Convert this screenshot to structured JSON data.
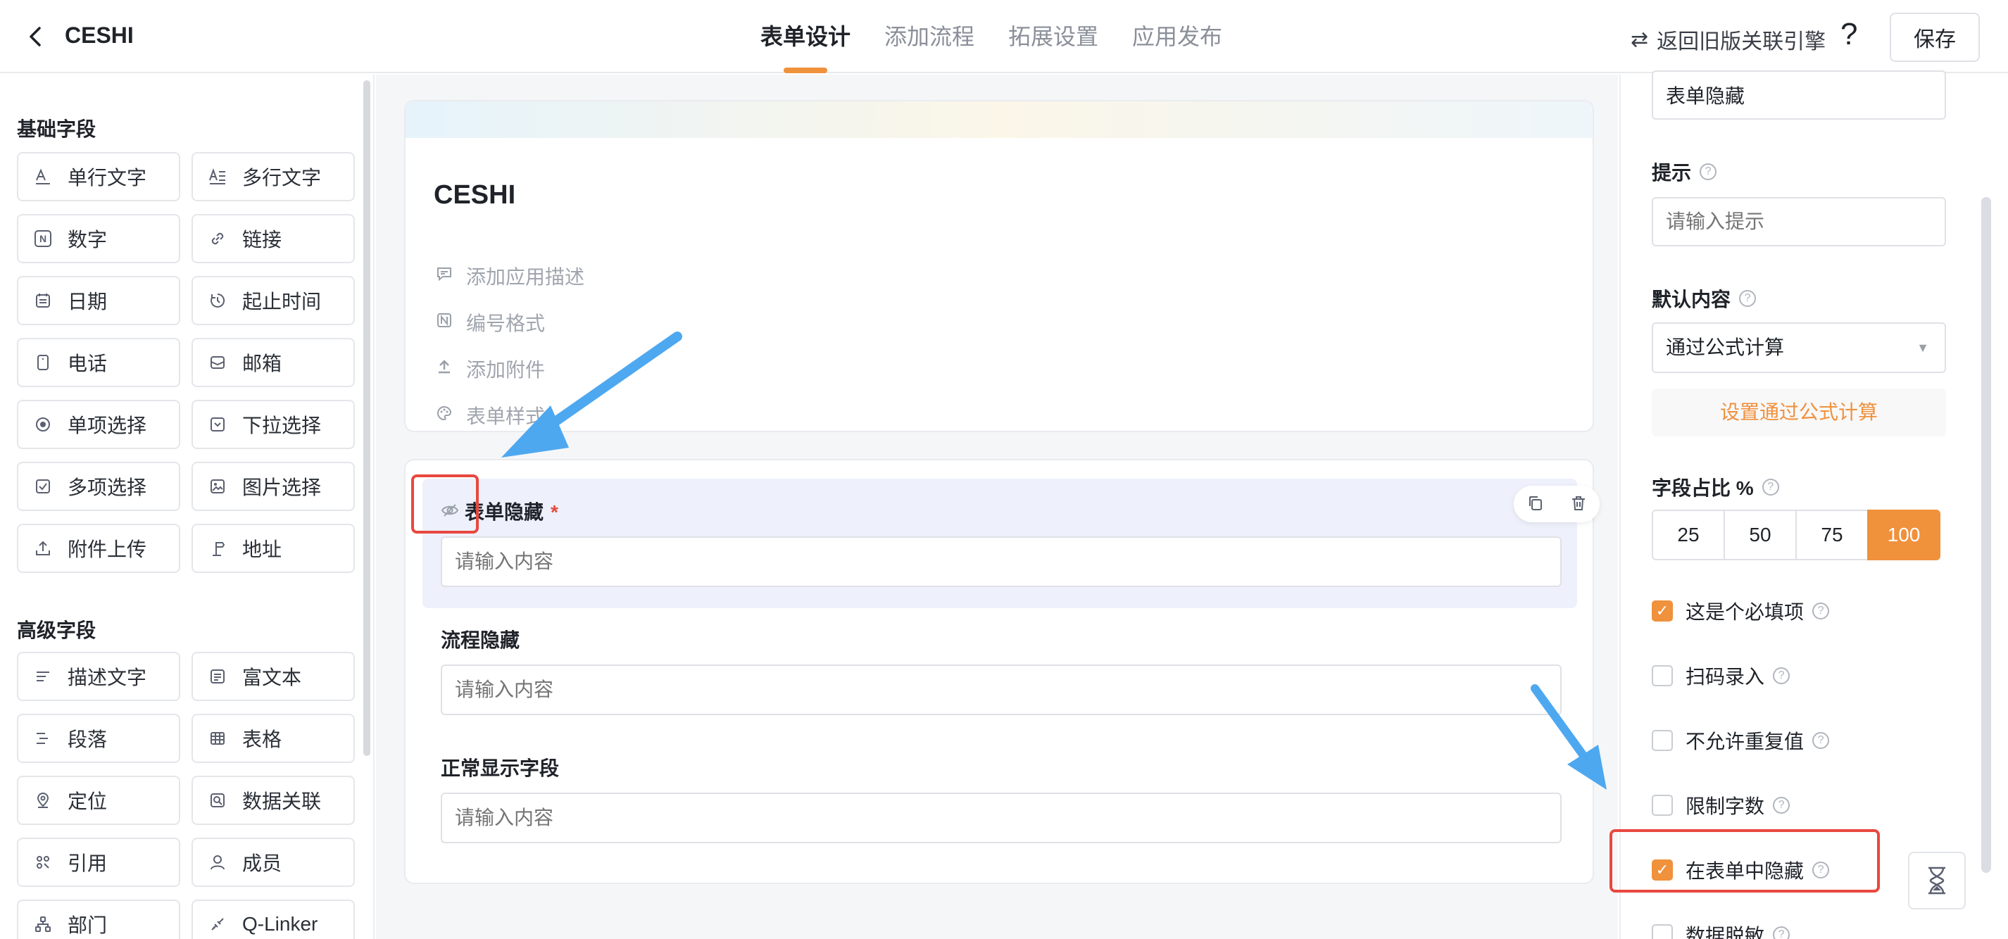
{
  "header": {
    "app_title": "CESHI",
    "tabs": [
      {
        "label": "表单设计"
      },
      {
        "label": "添加流程"
      },
      {
        "label": "拓展设置"
      },
      {
        "label": "应用发布"
      }
    ],
    "active_tab": "表单设计",
    "legacy_link": "返回旧版关联引擎",
    "help": "?",
    "save_label": "保存"
  },
  "left_panel": {
    "basic_title": "基础字段",
    "basic_fields": [
      {
        "label": "单行文字",
        "icon": "single-line-text-icon"
      },
      {
        "label": "多行文字",
        "icon": "multi-line-text-icon"
      },
      {
        "label": "数字",
        "icon": "number-icon"
      },
      {
        "label": "链接",
        "icon": "link-icon"
      },
      {
        "label": "日期",
        "icon": "calendar-icon"
      },
      {
        "label": "起止时间",
        "icon": "time-range-icon"
      },
      {
        "label": "电话",
        "icon": "phone-icon"
      },
      {
        "label": "邮箱",
        "icon": "mail-icon"
      },
      {
        "label": "单项选择",
        "icon": "radio-icon"
      },
      {
        "label": "下拉选择",
        "icon": "dropdown-icon"
      },
      {
        "label": "多项选择",
        "icon": "checkbox-icon"
      },
      {
        "label": "图片选择",
        "icon": "image-icon"
      },
      {
        "label": "附件上传",
        "icon": "upload-icon"
      },
      {
        "label": "地址",
        "icon": "address-icon"
      }
    ],
    "advanced_title": "高级字段",
    "advanced_fields": [
      {
        "label": "描述文字",
        "icon": "description-icon"
      },
      {
        "label": "富文本",
        "icon": "rich-text-icon"
      },
      {
        "label": "段落",
        "icon": "paragraph-icon"
      },
      {
        "label": "表格",
        "icon": "table-icon"
      },
      {
        "label": "定位",
        "icon": "location-icon"
      },
      {
        "label": "数据关联",
        "icon": "data-link-icon"
      },
      {
        "label": "引用",
        "icon": "reference-icon"
      },
      {
        "label": "成员",
        "icon": "member-icon"
      },
      {
        "label": "部门",
        "icon": "department-icon"
      },
      {
        "label": "Q-Linker",
        "icon": "qlinker-icon"
      }
    ]
  },
  "canvas": {
    "form_title": "CESHI",
    "meta_items": [
      {
        "label": "添加应用描述",
        "icon": "comment-icon"
      },
      {
        "label": "编号格式",
        "icon": "number-format-icon"
      },
      {
        "label": "添加附件",
        "icon": "attachment-upload-icon"
      },
      {
        "label": "表单样式",
        "icon": "palette-icon"
      }
    ],
    "fields": [
      {
        "label": "表单隐藏",
        "required": "*",
        "placeholder": "请输入内容"
      },
      {
        "label": "流程隐藏",
        "placeholder": "请输入内容"
      },
      {
        "label": "正常显示字段",
        "placeholder": "请输入内容"
      }
    ]
  },
  "right_panel": {
    "title_value": "表单隐藏",
    "hint_label": "提示",
    "hint_placeholder": "请输入提示",
    "default_label": "默认内容",
    "default_value": "通过公式计算",
    "formula_button": "设置通过公式计算",
    "ratio_label": "字段占比 %",
    "ratio_options": [
      "25",
      "50",
      "75",
      "100"
    ],
    "ratio_selected": "100",
    "checkboxes": [
      {
        "label": "这是个必填项",
        "checked": true
      },
      {
        "label": "扫码录入",
        "checked": false
      },
      {
        "label": "不允许重复值",
        "checked": false
      },
      {
        "label": "限制字数",
        "checked": false
      },
      {
        "label": "在表单中隐藏",
        "checked": true
      },
      {
        "label": "数据脱敏",
        "checked": false
      }
    ]
  },
  "colors": {
    "accent": "#f0913c",
    "arrow": "#4ea8f0",
    "highlight_box": "#e8483f"
  }
}
